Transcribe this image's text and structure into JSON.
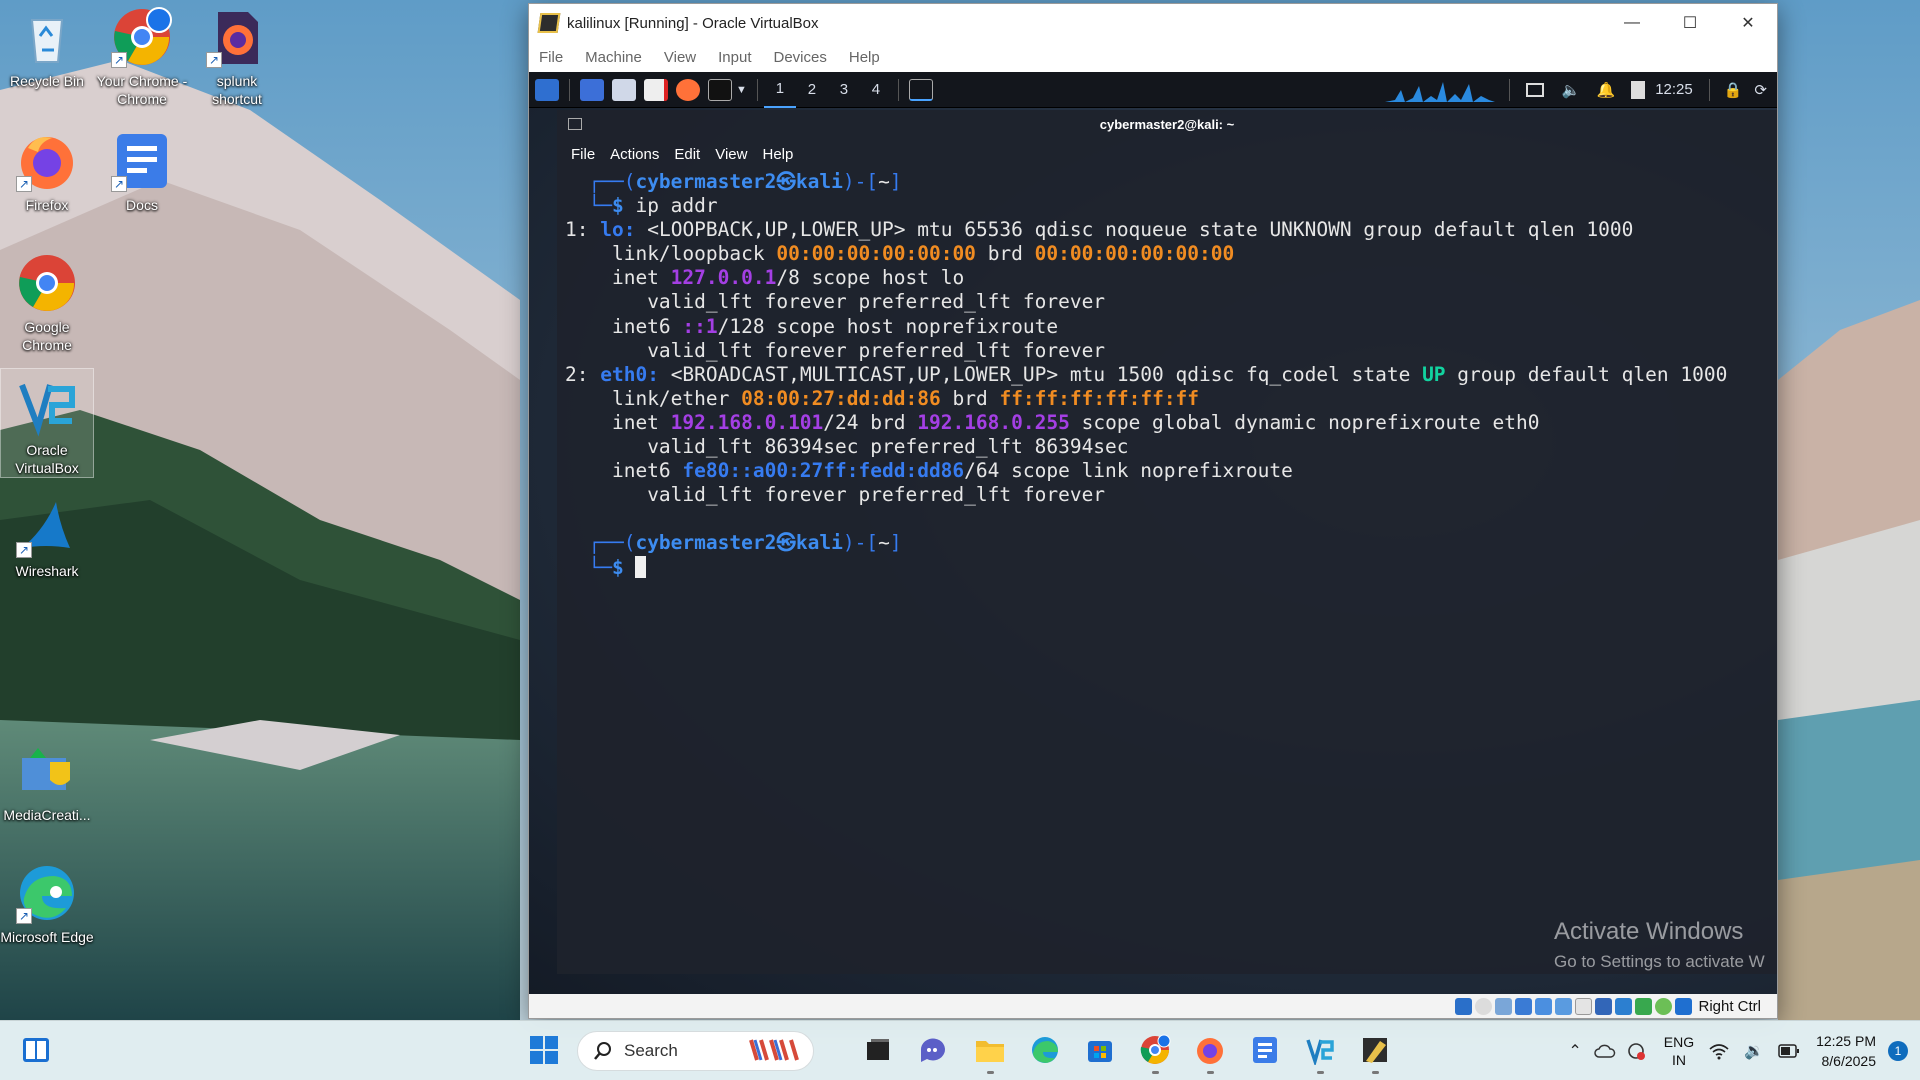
{
  "desktop": {
    "icons": [
      {
        "label": "Recycle Bin",
        "icon": "recycle-bin-icon"
      },
      {
        "label": "Your Chrome - Chrome",
        "icon": "chrome-profile-icon"
      },
      {
        "label": "splunk shortcut",
        "icon": "firefox-file-icon"
      },
      {
        "label": "Firefox",
        "icon": "firefox-icon"
      },
      {
        "label": "Docs",
        "icon": "docs-icon"
      },
      {
        "label": "Google Chrome",
        "icon": "chrome-icon"
      },
      {
        "label": "Oracle VirtualBox",
        "icon": "virtualbox-icon"
      },
      {
        "label": "Wireshark",
        "icon": "wireshark-icon"
      },
      {
        "label": "MediaCreati...",
        "icon": "media-creation-tool-icon"
      },
      {
        "label": "Microsoft Edge",
        "icon": "edge-icon"
      }
    ],
    "watermark": {
      "line1": "Activate Windows",
      "line2": "Go to Settings to activate W"
    }
  },
  "vbox": {
    "title": "kalilinux [Running] - Oracle VirtualBox",
    "menu": [
      "File",
      "Machine",
      "View",
      "Input",
      "Devices",
      "Help"
    ],
    "host_key": "Right Ctrl"
  },
  "kali_panel": {
    "workspaces": [
      "1",
      "2",
      "3",
      "4"
    ],
    "active_workspace": "1",
    "clock": "12:25"
  },
  "terminal": {
    "title": "cybermaster2@kali: ~",
    "menu": [
      "File",
      "Actions",
      "Edit",
      "View",
      "Help"
    ],
    "user": "cybermaster2",
    "host": "kali",
    "cwd": "~",
    "command": "ip addr",
    "lo": {
      "index": "1:",
      "name": "lo:",
      "flags": "<LOOPBACK,UP,LOWER_UP> mtu 65536 qdisc noqueue state UNKNOWN group default qlen 1000",
      "link_type": "link/loopback",
      "mac": "00:00:00:00:00:00",
      "brd_label": "brd",
      "brd": "00:00:00:00:00:00",
      "inet_ip": "127.0.0.1",
      "inet_rest": "/8 scope host lo",
      "lft1": "valid_lft forever preferred_lft forever",
      "inet6_ip": "::1",
      "inet6_rest": "/128 scope host noprefixroute",
      "lft2": "valid_lft forever preferred_lft forever"
    },
    "eth0": {
      "index": "2:",
      "name": "eth0:",
      "flags_a": "<BROADCAST,MULTICAST,UP,LOWER_UP> mtu 1500 qdisc fq_codel state",
      "state": "UP",
      "flags_b": "group default qlen 1000",
      "link_type": "link/ether",
      "mac": "08:00:27:dd:dd:86",
      "brd_label": "brd",
      "brd": "ff:ff:ff:ff:ff:ff",
      "inet_ip": "192.168.0.101",
      "inet_mid": "/24 brd",
      "inet_brd": "192.168.0.255",
      "inet_rest": "scope global dynamic noprefixroute eth0",
      "lft1": "valid_lft 86394sec preferred_lft 86394sec",
      "inet6_ip": "fe80::a00:27ff:fedd:dd86",
      "inet6_rest": "/64 scope link noprefixroute",
      "lft2": "valid_lft forever preferred_lft forever"
    }
  },
  "taskbar": {
    "search_placeholder": "Search",
    "lang_line1": "ENG",
    "lang_line2": "IN",
    "time": "12:25 PM",
    "date": "8/6/2025",
    "notification_count": "1"
  }
}
